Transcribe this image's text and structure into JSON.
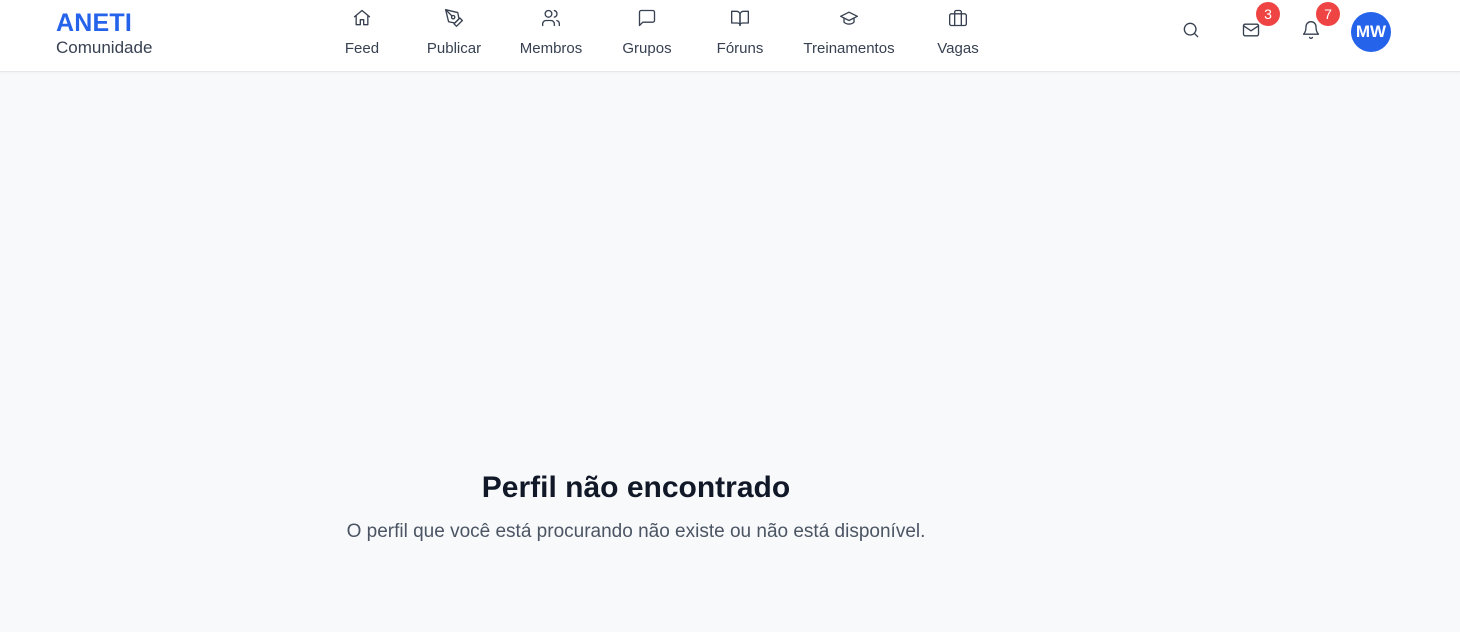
{
  "brand": {
    "title": "ANETI",
    "subtitle": "Comunidade",
    "accent": "#2563eb"
  },
  "nav": {
    "items": [
      {
        "label": "Feed",
        "icon": "home-icon"
      },
      {
        "label": "Publicar",
        "icon": "pen-tool-icon"
      },
      {
        "label": "Membros",
        "icon": "users-icon"
      },
      {
        "label": "Grupos",
        "icon": "message-square-icon"
      },
      {
        "label": "Fóruns",
        "icon": "book-open-icon"
      },
      {
        "label": "Treinamentos",
        "icon": "graduation-cap-icon"
      },
      {
        "label": "Vagas",
        "icon": "briefcase-icon"
      }
    ]
  },
  "actions": {
    "search_icon": "search-icon",
    "messages": {
      "icon": "mail-icon",
      "count": "3"
    },
    "notifications": {
      "icon": "bell-icon",
      "count": "7"
    },
    "badge_color": "#ef4444",
    "avatar": {
      "initials": "MW",
      "color": "#2563eb"
    }
  },
  "main": {
    "title": "Perfil não encontrado",
    "message": "O perfil que você está procurando não existe ou não está disponível."
  }
}
